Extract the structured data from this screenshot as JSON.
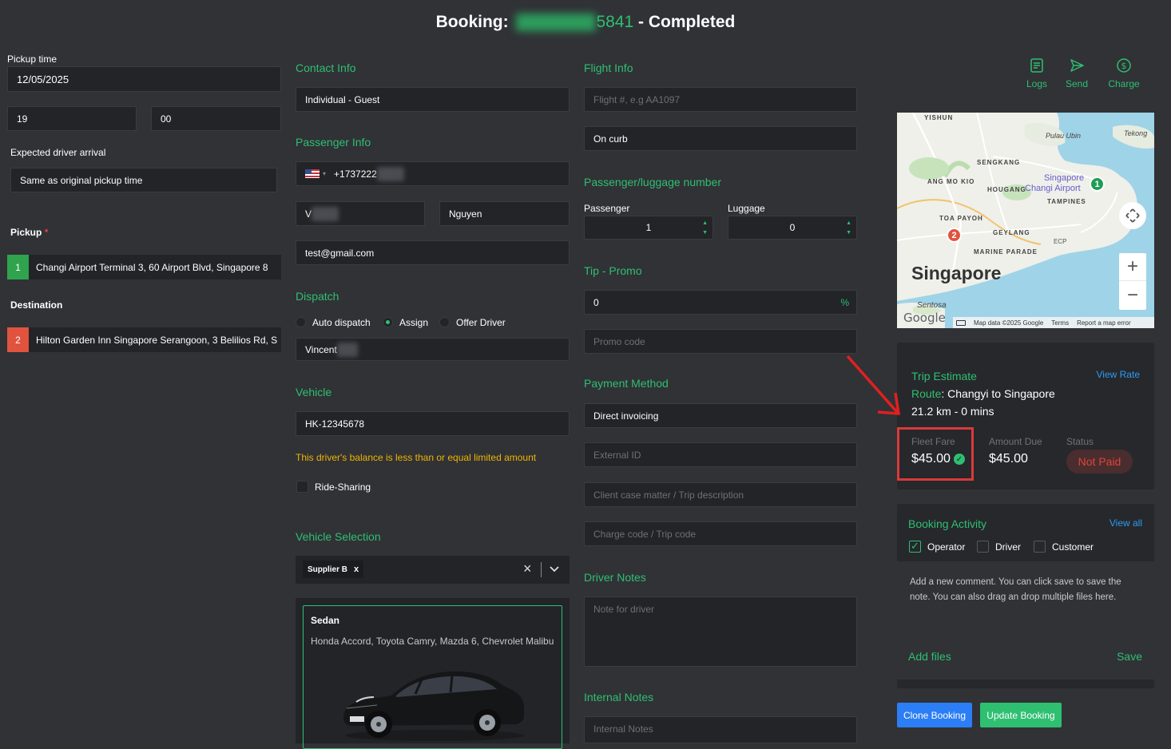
{
  "header": {
    "prefix": "Booking:",
    "booking_id_tail": "5841",
    "status": "- Completed"
  },
  "left": {
    "pickup_time_label": "Pickup time",
    "pickup_date": "12/05/2025",
    "pickup_hour": "19",
    "pickup_minute": "00",
    "expected_arrival_label": "Expected driver arrival",
    "expected_arrival_value": "Same as original pickup time",
    "pickup_label": "Pickup",
    "required_mark": "*",
    "pickup_index": "1",
    "pickup_address": "Changi Airport Terminal 3, 60 Airport Blvd, Singapore 8",
    "destination_label": "Destination",
    "destination_index": "2",
    "destination_address": "Hilton Garden Inn Singapore Serangoon, 3 Belilios Rd, S"
  },
  "contact": {
    "title": "Contact Info",
    "type_value": "Individual - Guest"
  },
  "passenger": {
    "title": "Passenger Info",
    "phone": "+1737222",
    "first_name": "V",
    "last_name": "Nguyen",
    "email": "test@gmail.com"
  },
  "dispatch": {
    "title": "Dispatch",
    "options": [
      "Auto dispatch",
      "Assign",
      "Offer Driver"
    ],
    "selected": "Assign",
    "driver": "Vincent"
  },
  "vehicle": {
    "title": "Vehicle",
    "plate": "HK-12345678",
    "warning": "This driver's balance is less than or equal limited amount",
    "ride_sharing_label": "Ride-Sharing"
  },
  "vehicle_selection": {
    "title": "Vehicle Selection",
    "chip": "Supplier B",
    "chip_remove": "x",
    "clear": "×",
    "card_title": "Sedan",
    "card_desc": "Honda Accord, Toyota Camry, Mazda 6, Chevrolet Malibu"
  },
  "flight": {
    "title": "Flight Info",
    "flight_placeholder": "Flight #, e.g AA1097",
    "meet_value": "On curb"
  },
  "pax_luggage": {
    "title": "Passenger/luggage number",
    "passenger_label": "Passenger",
    "passenger_value": "1",
    "luggage_label": "Luggage",
    "luggage_value": "0"
  },
  "tip": {
    "title": "Tip - Promo",
    "tip_value": "0",
    "tip_unit": "%",
    "promo_placeholder": "Promo code"
  },
  "payment": {
    "title": "Payment Method",
    "method": "Direct invoicing",
    "external_id_placeholder": "External ID",
    "client_case_placeholder": "Client case matter / Trip description",
    "charge_code_placeholder": "Charge code / Trip code"
  },
  "driver_notes": {
    "title": "Driver Notes",
    "placeholder": "Note for driver"
  },
  "internal_notes": {
    "title": "Internal Notes",
    "placeholder": "Internal Notes"
  },
  "actions": {
    "logs": "Logs",
    "send": "Send",
    "charge": "Charge"
  },
  "map": {
    "city": "Singapore",
    "labels": [
      "YISHUN",
      "Pulau Ubin",
      "Tekong",
      "SENGKANG",
      "ANG MO KIO",
      "HOUGANG",
      "Singapore",
      "Changi Airport",
      "TAMPINES",
      "TOA PAYOH",
      "GEYLANG",
      "ECP",
      "MARINE PARADE",
      "Sentosa"
    ],
    "attribution": "Map data ©2025 Google",
    "terms": "Terms",
    "report": "Report a map error",
    "google": "Google",
    "zoom_in": "+",
    "zoom_out": "−",
    "marker1": "1",
    "marker2": "2"
  },
  "trip": {
    "title": "Trip Estimate",
    "view_rate": "View Rate",
    "route_label": "Route",
    "route_value": ": Changyi to Singapore",
    "distance": "21.2 km - 0 mins",
    "fleet_fare_label": "Fleet Fare",
    "fleet_fare": "$45.00",
    "amount_due_label": "Amount Due",
    "amount_due": "$45.00",
    "status_label": "Status",
    "status": "Not Paid"
  },
  "activity": {
    "title": "Booking Activity",
    "view_all": "View all",
    "filters": [
      "Operator",
      "Driver",
      "Customer"
    ],
    "comment_hint": "Add a new comment. You can click save to save the note. You can also drag an drop multiple files here.",
    "add_files": "Add files",
    "save": "Save"
  },
  "footer": {
    "clone": "Clone Booking",
    "update": "Update Booking"
  },
  "colors": {
    "accent": "#2fbf71",
    "background": "#303236",
    "field": "#222428",
    "danger": "#e0433b",
    "warning": "#f0b400",
    "clone_button": "#2b7ef5"
  }
}
